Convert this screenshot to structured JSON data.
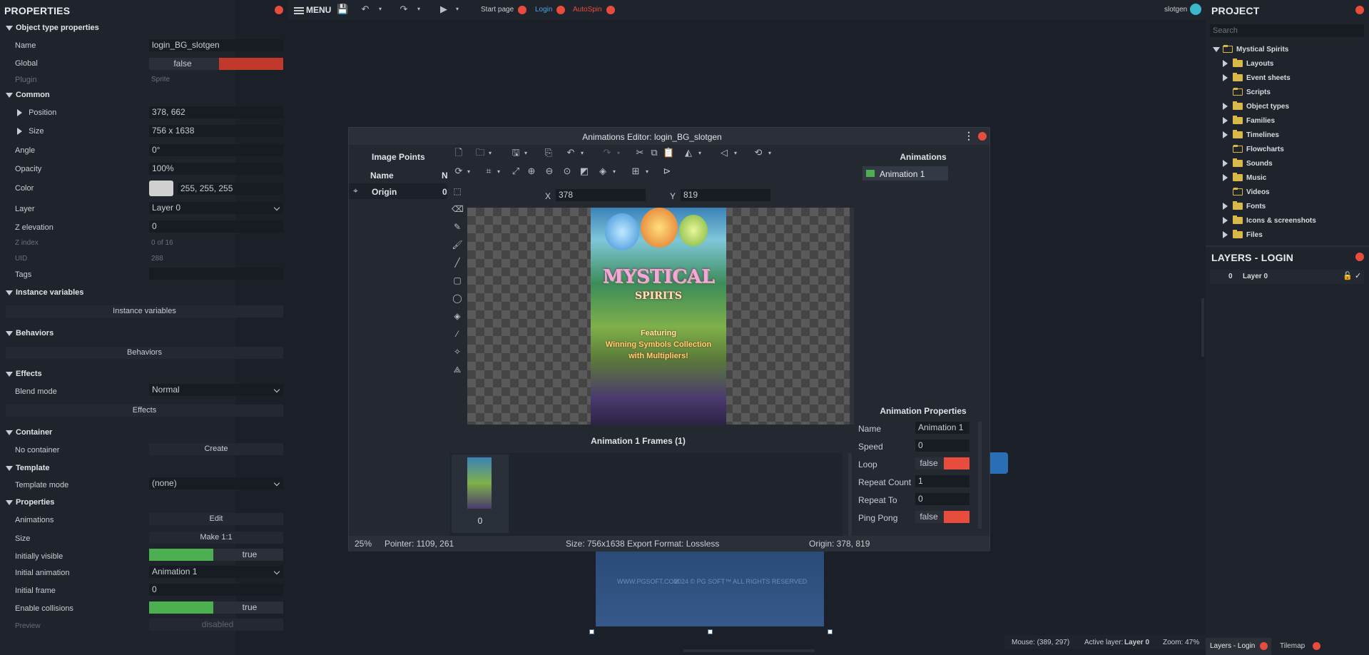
{
  "properties": {
    "title": "PROPERTIES",
    "sections": {
      "object_type": "Object type properties",
      "common": "Common",
      "instance_variables": "Instance variables",
      "behaviors": "Behaviors",
      "effects": "Effects",
      "container": "Container",
      "template": "Template",
      "properties": "Properties"
    },
    "name_label": "Name",
    "name_value": "login_BG_slotgen",
    "global_label": "Global",
    "global_value": "false",
    "plugin_label": "Plugin",
    "plugin_value": "Sprite",
    "position_label": "Position",
    "position_value": "378, 662",
    "size_label": "Size",
    "size_value": "756 x 1638",
    "angle_label": "Angle",
    "angle_value": "0°",
    "opacity_label": "Opacity",
    "opacity_value": "100%",
    "color_label": "Color",
    "color_value": "255, 255, 255",
    "layer_label": "Layer",
    "layer_value": "Layer 0",
    "zelev_label": "Z elevation",
    "zelev_value": "0",
    "zindex_label": "Z index",
    "zindex_value": "0 of 16",
    "uid_label": "UID",
    "uid_value": "288",
    "tags_label": "Tags",
    "tags_value": "",
    "instance_variables_button": "Instance variables",
    "behaviors_button": "Behaviors",
    "blend_label": "Blend mode",
    "blend_value": "Normal",
    "effects_button": "Effects",
    "no_container_label": "No container",
    "create_button": "Create",
    "template_mode_label": "Template mode",
    "template_mode_value": "(none)",
    "animations_label": "Animations",
    "edit_button": "Edit",
    "size2_label": "Size",
    "make11_button": "Make 1:1",
    "init_visible_label": "Initially visible",
    "init_visible_value": "true",
    "init_anim_label": "Initial animation",
    "init_anim_value": "Animation 1",
    "init_frame_label": "Initial frame",
    "init_frame_value": "0",
    "collisions_label": "Enable collisions",
    "collisions_value": "true",
    "preview_label": "Preview",
    "preview_value": "disabled"
  },
  "toolbar": {
    "menu_label": "MENU",
    "tabs": [
      {
        "label": "Start page",
        "color": "#c9cdd3"
      },
      {
        "label": "Login",
        "color": "#4aa3df"
      },
      {
        "label": "AutoSpin",
        "color": "#e74c3c"
      }
    ],
    "user": "slotgen"
  },
  "project": {
    "title": "PROJECT",
    "search_placeholder": "Search",
    "root": "Mystical Spirits",
    "items": [
      {
        "label": "Layouts",
        "expandable": true
      },
      {
        "label": "Event sheets",
        "expandable": true
      },
      {
        "label": "Scripts",
        "expandable": false
      },
      {
        "label": "Object types",
        "expandable": true
      },
      {
        "label": "Families",
        "expandable": true
      },
      {
        "label": "Timelines",
        "expandable": true
      },
      {
        "label": "Flowcharts",
        "expandable": false
      },
      {
        "label": "Sounds",
        "expandable": true
      },
      {
        "label": "Music",
        "expandable": true
      },
      {
        "label": "Videos",
        "expandable": false
      },
      {
        "label": "Fonts",
        "expandable": true
      },
      {
        "label": "Icons & screenshots",
        "expandable": true
      },
      {
        "label": "Files",
        "expandable": true
      }
    ]
  },
  "layers": {
    "title": "LAYERS - LOGIN",
    "rows": [
      {
        "index": "0",
        "name": "Layer 0"
      }
    ]
  },
  "dialog": {
    "title": "Animations Editor: login_BG_slotgen",
    "image_points_title": "Image Points",
    "col_name": "Name",
    "col_n": "N",
    "origin_label": "Origin",
    "origin_value": "0",
    "x_label": "X",
    "x_value": "378",
    "y_label": "Y",
    "y_value": "819",
    "game_title": "MYSTICAL",
    "game_subtitle": "SPIRITS",
    "game_featuring": "Featuring",
    "game_tag1": "Winning Symbols Collection",
    "game_tag2": "with Multipliers!",
    "animations_title": "Animations",
    "animation_item": "Animation 1",
    "anim_props_title": "Animation Properties",
    "prop_name_label": "Name",
    "prop_name_value": "Animation 1",
    "prop_speed_label": "Speed",
    "prop_speed_value": "0",
    "prop_loop_label": "Loop",
    "prop_loop_value": "false",
    "prop_repeat_label": "Repeat Count",
    "prop_repeat_value": "1",
    "prop_repeatto_label": "Repeat To",
    "prop_repeatto_value": "0",
    "prop_pingpong_label": "Ping Pong",
    "prop_pingpong_value": "false",
    "frames_title": "Animation 1 Frames (1)",
    "frame_index": "0",
    "status_zoom": "25%",
    "status_pointer": "Pointer: 1109, 261",
    "status_size": "Size: 756x1638",
    "status_export": "Export Format: Lossless",
    "status_origin": "Origin: 378, 819"
  },
  "layout_canvas": {
    "footer_text1": "WWW.PGSOFT.COM",
    "footer_text2": "2024 © PG SOFT™ ALL RIGHTS RESERVED"
  },
  "statusbar": {
    "mouse": "Mouse: (389, 297)",
    "active_layer_label": "Active layer:",
    "active_layer_value": "Layer 0",
    "zoom": "Zoom: 47%",
    "tab_layers": "Layers - Login",
    "tab_tilemap": "Tilemap"
  },
  "colors": {
    "red": "#e74c3c",
    "green": "#4caf50",
    "accent": "#4aa3df"
  }
}
